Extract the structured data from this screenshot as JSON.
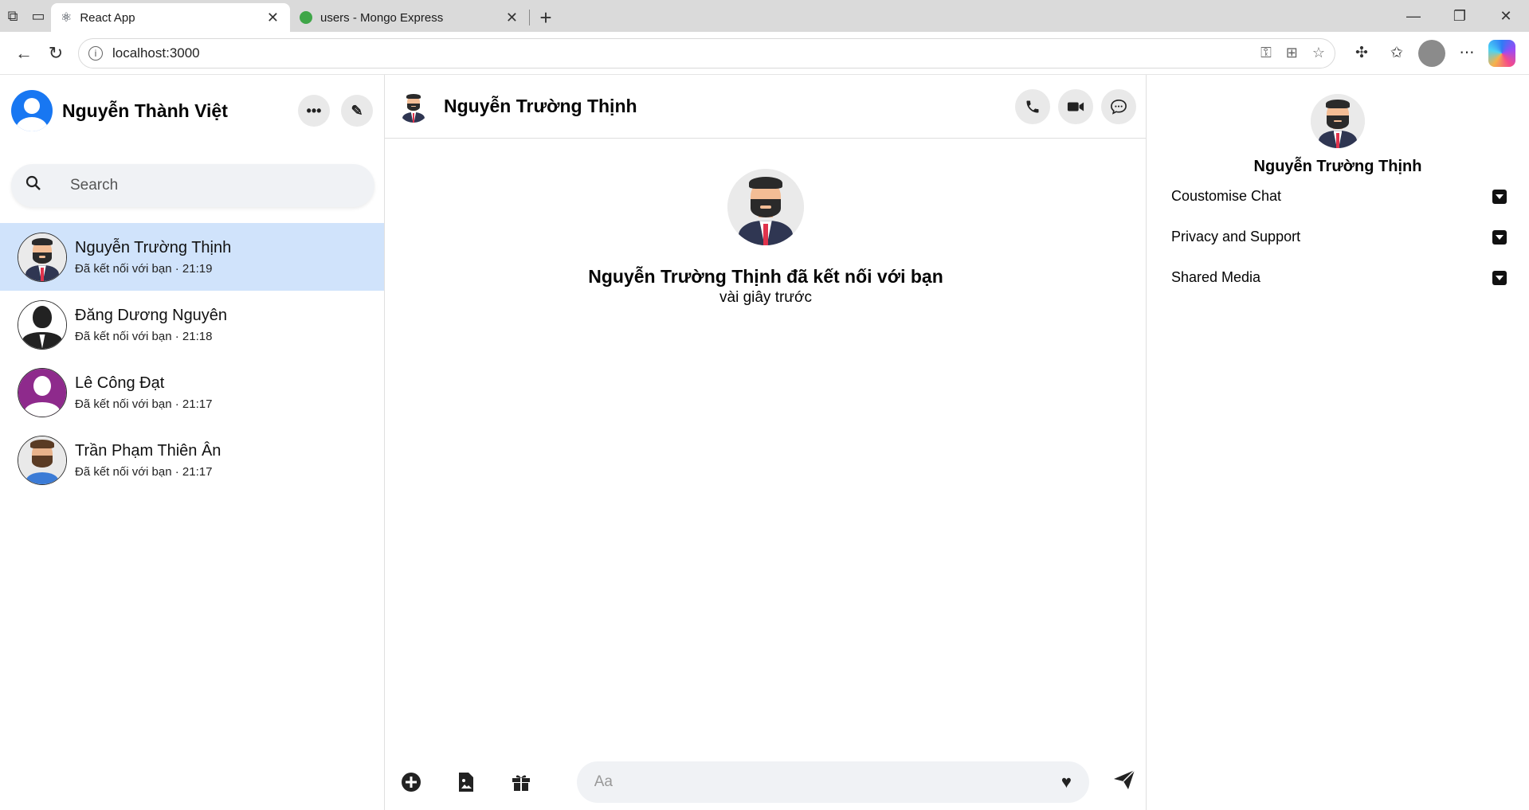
{
  "browser": {
    "tabs": [
      {
        "title": "React App",
        "active": true
      },
      {
        "title": "users - Mongo Express",
        "active": false
      }
    ],
    "url": "localhost:3000"
  },
  "sidebar": {
    "user_name": "Nguyễn Thành Việt",
    "search_placeholder": "Search",
    "conversations": [
      {
        "name": "Nguyễn Trường Thịnh",
        "subtitle": "Đã kết nối với bạn · 21:19",
        "avatar": "man-tie-avatar",
        "active": true
      },
      {
        "name": "Đăng Dương Nguyên",
        "subtitle": "Đã kết nối với bạn · 21:18",
        "avatar": "silhouette-avatar",
        "active": false
      },
      {
        "name": "Lê Công Đạt",
        "subtitle": "Đã kết nối với bạn · 21:17",
        "avatar": "purple-avatar",
        "active": false
      },
      {
        "name": "Trần Phạm Thiên Ân",
        "subtitle": "Đã kết nối với bạn · 21:17",
        "avatar": "bearded-avatar",
        "active": false
      }
    ]
  },
  "chat": {
    "contact_name": "Nguyễn Trường Thịnh",
    "intro_title": "Nguyễn Trường Thịnh đã kết nối với bạn",
    "intro_sub": "vài giây trước",
    "composer_placeholder": "Aa"
  },
  "info_panel": {
    "name": "Nguyễn Trường Thịnh",
    "sections": [
      "Coustomise Chat",
      "Privacy and Support",
      "Shared Media"
    ]
  },
  "colors": {
    "accent": "#1877f2",
    "active_conversation": "#d0e3fb",
    "input_bg": "#f0f2f5"
  }
}
